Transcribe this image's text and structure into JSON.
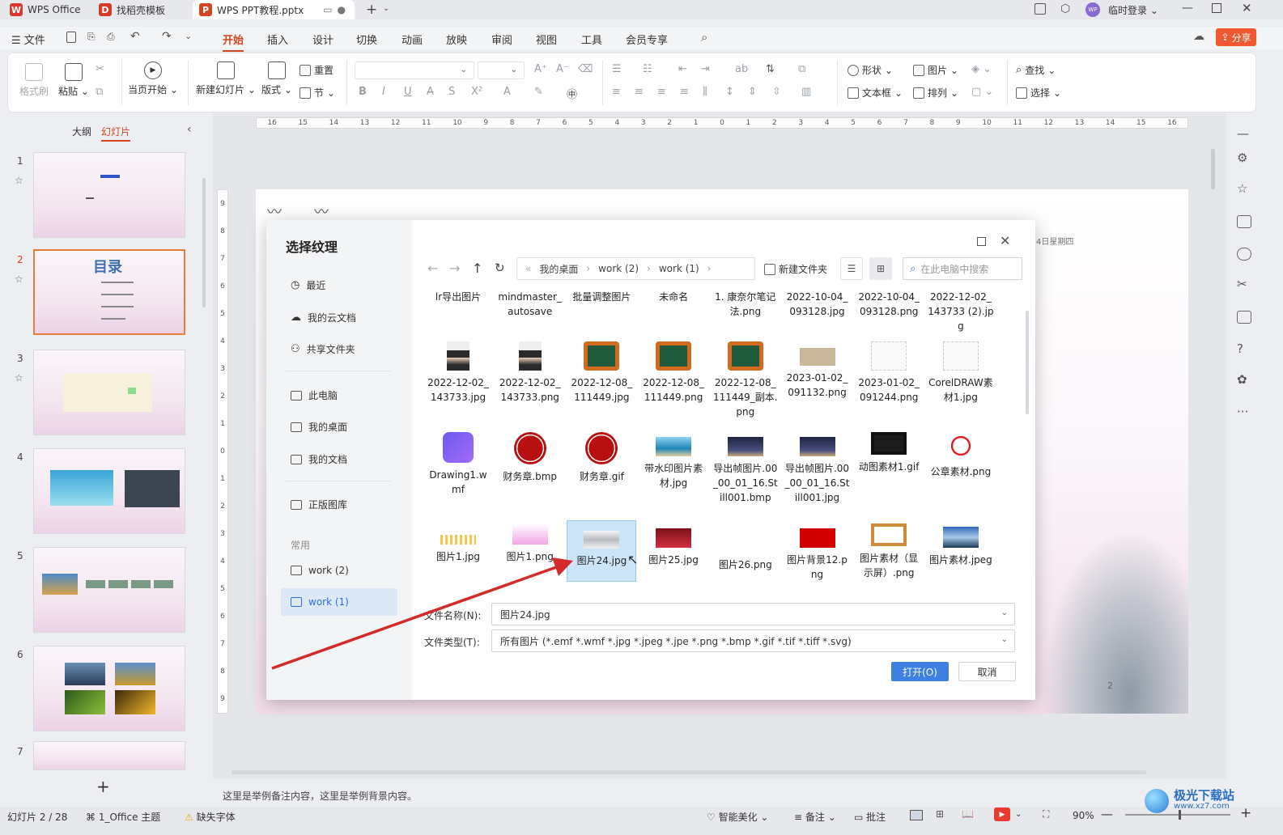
{
  "titlebar": {
    "tabs": [
      {
        "label": "WPS Office",
        "icon": "wps-logo-icon"
      },
      {
        "label": "找稻壳模板",
        "icon": "docer-logo-icon"
      },
      {
        "label": "WPS PPT教程.pptx",
        "icon": "ppt-logo-icon"
      }
    ],
    "login": "临时登录",
    "avatar_text": "WP"
  },
  "menu": {
    "file": "文件",
    "items": [
      "开始",
      "插入",
      "设计",
      "切换",
      "动画",
      "放映",
      "审阅",
      "视图",
      "工具",
      "会员专享"
    ],
    "active": "开始",
    "share": "分享"
  },
  "ribbon": {
    "format_painter": "格式刷",
    "paste": "粘贴",
    "play_current": "当页开始",
    "new_slide": "新建幻灯片",
    "layout": "版式",
    "reset": "重置",
    "section": "节",
    "shape": "形状",
    "picture": "图片",
    "find": "查找",
    "textbox": "文本框",
    "arrange": "排列",
    "select": "选择"
  },
  "left_panel": {
    "tab_outline": "大纲",
    "tab_slides": "幻灯片",
    "slides": [
      "1",
      "2",
      "3",
      "4",
      "5",
      "6",
      "7"
    ],
    "thumb2_title": "目录",
    "add": "+"
  },
  "rulers": {
    "h_ticks": [
      "16",
      "15",
      "14",
      "13",
      "12",
      "11",
      "10",
      "9",
      "8",
      "7",
      "6",
      "5",
      "4",
      "3",
      "2",
      "1",
      "0",
      "1",
      "2",
      "3",
      "4",
      "5",
      "6",
      "7",
      "8",
      "9",
      "10",
      "11",
      "12",
      "13",
      "14",
      "15",
      "16"
    ],
    "v_ticks": [
      "9",
      "8",
      "7",
      "6",
      "5",
      "4",
      "3",
      "2",
      "1",
      "0",
      "1",
      "2",
      "3",
      "4",
      "5",
      "6",
      "7",
      "8",
      "9"
    ]
  },
  "slide": {
    "date_text": "4日星期四",
    "page_number": "2"
  },
  "dialog": {
    "title": "选择纹理",
    "sidebar": {
      "recent": "最近",
      "cloud": "我的云文档",
      "shared": "共享文件夹",
      "this_pc": "此电脑",
      "desktop": "我的桌面",
      "documents": "我的文档",
      "gallery": "正版图库",
      "common": "常用",
      "work2": "work (2)",
      "work1": "work (1)"
    },
    "breadcrumb": [
      "我的桌面",
      "work (2)",
      "work (1)"
    ],
    "new_folder": "新建文件夹",
    "search_placeholder": "在此电脑中搜索",
    "files": [
      {
        "name": "lr导出图片",
        "kind": "folder"
      },
      {
        "name": "mindmaster_autosave",
        "kind": "folder"
      },
      {
        "name": "批量调整图片",
        "kind": "folder"
      },
      {
        "name": "未命名",
        "kind": "folder"
      },
      {
        "name": "1. 康奈尔笔记法.png",
        "kind": "image"
      },
      {
        "name": "2022-10-04_093128.jpg",
        "kind": "image"
      },
      {
        "name": "2022-10-04_093128.png",
        "kind": "image"
      },
      {
        "name": "2022-12-02_143733 (2).jpg",
        "kind": "image"
      },
      {
        "name": "2022-12-02_143733.jpg",
        "kind": "portrait"
      },
      {
        "name": "2022-12-02_143733.png",
        "kind": "portrait"
      },
      {
        "name": "2022-12-08_111449.jpg",
        "kind": "board"
      },
      {
        "name": "2022-12-08_111449.png",
        "kind": "board"
      },
      {
        "name": "2022-12-08_111449_副本.png",
        "kind": "board"
      },
      {
        "name": "2023-01-02_091132.png",
        "kind": "beige"
      },
      {
        "name": "2023-01-02_091244.png",
        "kind": "sketch"
      },
      {
        "name": "CorelDRAW素材1.jpg",
        "kind": "sketch"
      },
      {
        "name": "Drawing1.wmf",
        "kind": "app"
      },
      {
        "name": "财务章.bmp",
        "kind": "seal"
      },
      {
        "name": "财务章.gif",
        "kind": "seal"
      },
      {
        "name": "带水印图片素材.jpg",
        "kind": "sea"
      },
      {
        "name": "导出帧图片.00_00_01_16.Still001.bmp",
        "kind": "city"
      },
      {
        "name": "导出帧图片.00_00_01_16.Still001.jpg",
        "kind": "city"
      },
      {
        "name": "动图素材1.gif",
        "kind": "dark"
      },
      {
        "name": "公章素材.png",
        "kind": "stamp"
      },
      {
        "name": "图片1.jpg",
        "kind": "chart"
      },
      {
        "name": "图片1.png",
        "kind": "pink"
      },
      {
        "name": "图片24.jpg",
        "kind": "mist"
      },
      {
        "name": "图片25.jpg",
        "kind": "maroon"
      },
      {
        "name": "图片26.png",
        "kind": "blank"
      },
      {
        "name": "图片背景12.png",
        "kind": "red"
      },
      {
        "name": "图片素材（显示屏）.png",
        "kind": "frame"
      },
      {
        "name": "图片素材.jpeg",
        "kind": "lake"
      }
    ],
    "filename_label": "文件名称(N):",
    "filename_value": "图片24.jpg",
    "filetype_label": "文件类型(T):",
    "filetype_value": "所有图片 (*.emf *.wmf *.jpg *.jpeg *.jpe *.png *.bmp *.gif *.tif *.tiff *.svg)",
    "open": "打开(O)",
    "cancel": "取消"
  },
  "notes": "这里是举例备注内容，这里是举例背景内容。",
  "status": {
    "slide_count": "幻灯片 2 / 28",
    "theme": "1_Office 主题",
    "missing_font": "缺失字体",
    "beautify": "智能美化",
    "notes": "备注",
    "comments": "批注",
    "zoom": "90%"
  },
  "watermark": {
    "site": "极光下载站",
    "url": "www.xz7.com"
  },
  "colors": {
    "accent": "#d2451e",
    "primary_button": "#3d7fe3",
    "selection": "#cce4f7",
    "arrow": "#d42a2a"
  }
}
